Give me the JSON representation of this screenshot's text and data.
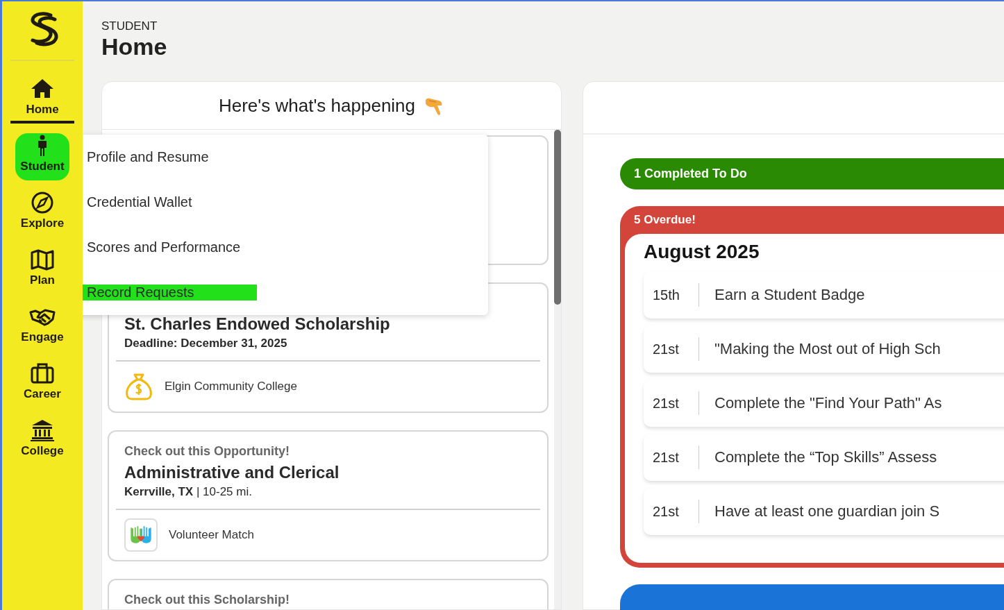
{
  "sidebar": {
    "items": [
      {
        "label": "Home",
        "selected": true,
        "highlighted": false
      },
      {
        "label": "Student",
        "selected": false,
        "highlighted": true
      },
      {
        "label": "Explore",
        "selected": false,
        "highlighted": false
      },
      {
        "label": "Plan",
        "selected": false,
        "highlighted": false
      },
      {
        "label": "Engage",
        "selected": false,
        "highlighted": false
      },
      {
        "label": "Career",
        "selected": false,
        "highlighted": false
      },
      {
        "label": "College",
        "selected": false,
        "highlighted": false
      }
    ]
  },
  "student_menu": {
    "items": [
      {
        "label": "Profile and Resume",
        "selected": false
      },
      {
        "label": "Credential Wallet",
        "selected": false
      },
      {
        "label": "Scores and Performance",
        "selected": false
      },
      {
        "label": "Record Requests",
        "selected": true
      }
    ]
  },
  "page": {
    "section": "STUDENT",
    "title": "Home"
  },
  "feed": {
    "title": "Here's what's happening",
    "cards": [
      {
        "kind": "covered"
      },
      {
        "kind": "scholarship",
        "title": "St. Charles Endowed Scholarship",
        "detail": "Deadline: December 31, 2025",
        "source": "Elgin Community College"
      },
      {
        "kind": "opportunity",
        "label": "Check out this Opportunity!",
        "title": "Administrative and Clerical",
        "detail": "**Kerrville, TX** | 10-25 mi.",
        "source": "Volunteer Match"
      },
      {
        "kind": "teaser",
        "label": "Check out this Scholarship!"
      }
    ]
  },
  "todos": {
    "sections": [
      {
        "kind": "completed",
        "label": "1 Completed To Do"
      },
      {
        "kind": "overdue",
        "label": "5 Overdue!",
        "month": "August 2025",
        "rows": [
          {
            "date": "15th",
            "text": "Earn a Student Badge"
          },
          {
            "date": "21st",
            "text": "\"Making the Most out of High Sch"
          },
          {
            "date": "21st",
            "text": "Complete the \"Find Your Path\" As"
          },
          {
            "date": "21st",
            "text": "Complete the “Top Skills” Assess"
          },
          {
            "date": "21st",
            "text": "Have at least one guardian join S"
          }
        ]
      },
      {
        "kind": "upcoming"
      }
    ]
  }
}
